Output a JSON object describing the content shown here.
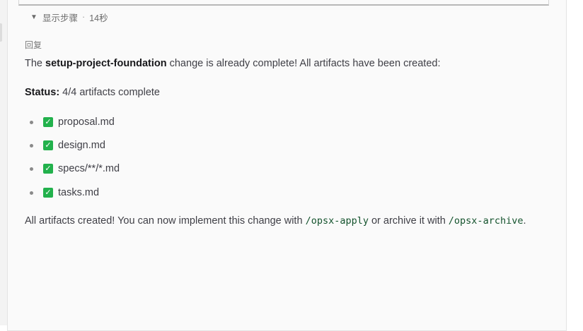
{
  "steps": {
    "label": "显示步骤",
    "separator": "·",
    "duration": "14秒"
  },
  "reply": {
    "label": "回复",
    "intro": {
      "before": "The ",
      "name": "setup-project-foundation",
      "after": " change is already complete! All artifacts have been created:"
    },
    "status": {
      "label": "Status:",
      "value": " 4/4 artifacts complete"
    },
    "artifacts": [
      "proposal.md",
      "design.md",
      "specs/**/*.md",
      "tasks.md"
    ],
    "closing": {
      "part1": "All artifacts created! You can now implement this change with ",
      "cmd1": "/opsx-apply",
      "part2": " or archive it with ",
      "cmd2": "/opsx-archive",
      "part3": "."
    }
  },
  "colors": {
    "check": "#22b14c",
    "code": "#14532d"
  },
  "icons": {
    "expand": "triangle-down-icon",
    "check": "checkbox-checked-icon"
  }
}
